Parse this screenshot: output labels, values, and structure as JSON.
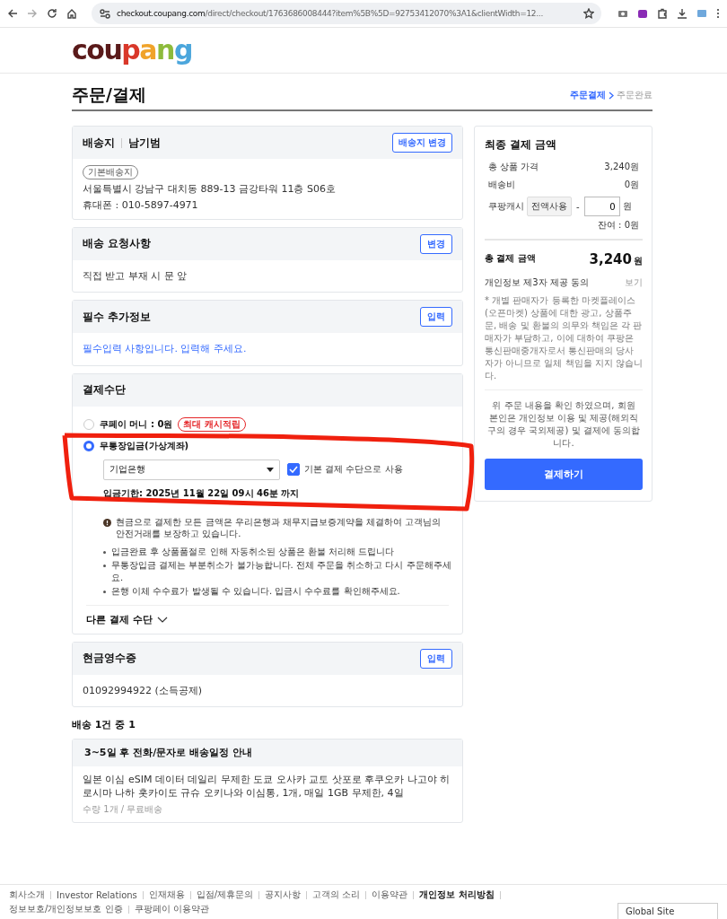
{
  "browser": {
    "url_host": "checkout.coupang.com",
    "url_path": "/direct/checkout/1763686008444?item%5B%5D=92753412070%3A1&clientWidth=12..."
  },
  "logo": "coupang",
  "page_title": "주문/결제",
  "steps": [
    {
      "label": "주문결제",
      "selected": true
    },
    {
      "label": "주문완료",
      "selected": false
    }
  ],
  "shipping_address": {
    "title": "배송지",
    "name": "남기범",
    "button": "배송지 변경",
    "badge": "기본배송지",
    "address": "서울특별시 강남구 대치동 889-13 금강타워 11층 S06호",
    "phone": "휴대폰 : 010-5897-4971"
  },
  "delivery_request": {
    "title": "배송 요청사항",
    "button": "변경",
    "text": "직접 받고 부재 시 문 앞"
  },
  "extra_info": {
    "title": "필수 추가정보",
    "button": "입력",
    "text": "필수입력 사항입니다. 입력해 주세요."
  },
  "payment": {
    "title": "결제수단",
    "methods": [
      {
        "label": "쿠페이 머니 : 0원",
        "badge": "최대 캐시적립",
        "selected": false
      },
      {
        "label": "무통장입금(가상계좌)",
        "selected": true
      }
    ],
    "bank_select": "기업은행",
    "default_checkbox": {
      "label": "기본 결제 수단으로 사용",
      "checked": true
    },
    "deadline": "입금기한:  2025년 11월 22일 09시 46분 까지",
    "notice": "현금으로 결제한 모든 금액은 우리은행과 채무지급보증계약을 체결하여 고객님의 안전거래를 보장하고 있습니다.",
    "bullets": [
      "입금완료 후 상품품절로 인해 자동취소된 상품은 환불 처리해 드립니다",
      "무통장입금 결제는 부분취소가 불가능합니다. 전체 주문을 취소하고 다시 주문해주세요.",
      "은행 이체 수수료가 발생될 수 있습니다. 입금시 수수료를 확인해주세요."
    ],
    "other_methods": "다른 결제 수단"
  },
  "cash_receipt": {
    "title": "현금영수증",
    "button": "입력",
    "text": "01092994922 (소득공제)"
  },
  "shipment": {
    "heading": "배송 1건 중 1",
    "title": "3~5일 후 전화/문자로 배송일정 안내",
    "product": "일본 이심 eSIM 데이터 데일리 무제한 도쿄 오사카 교토 삿포로 후쿠오카 나고야 히로시마 나하 홋카이도 규슈 오키나와 이심통, 1개, 매일 1GB 무제한, 4일",
    "meta": "수량 1개 / 무료배송"
  },
  "summary": {
    "title": "최종 결제 금액",
    "rows": [
      {
        "label": "총 상품 가격",
        "value": "3,240원"
      },
      {
        "label": "배송비",
        "value": "0원"
      }
    ],
    "cash": {
      "label": "쿠팡캐시",
      "button": "전액사용",
      "minus": "-",
      "value": "0",
      "unit": "원",
      "balance": "잔여 : 0원"
    },
    "total": {
      "label": "총 결제 금액",
      "amount": "3,240",
      "unit": "원"
    },
    "consent": {
      "label": "개인정보 제3자 제공 동의",
      "link": "보기"
    },
    "disclaimer": "* 개별 판매자가 등록한 마켓플레이스(오픈마켓) 상품에 대한 광고, 상품주문, 배송 및 환불의 의무와 책임은 각 판매자가 부담하고, 이에 대하여 쿠팡은 통신판매중개자로서 통신판매의 당사자가 아니므로 일체 책임을 지지 않습니다.",
    "agreement": "위 주문 내용을 확인 하였으며, 회원 본인은 개인정보 이용 및 제공(해외직구의 경우 국외제공) 및 결제에 동의합니다.",
    "pay_button": "결제하기"
  },
  "footer": {
    "links": [
      {
        "label": "회사소개",
        "bold": false
      },
      {
        "label": "Investor Relations",
        "bold": false
      },
      {
        "label": "인재채용",
        "bold": false
      },
      {
        "label": "입점/제휴문의",
        "bold": false
      },
      {
        "label": "공지사항",
        "bold": false
      },
      {
        "label": "고객의 소리",
        "bold": false
      },
      {
        "label": "이용약관",
        "bold": false
      },
      {
        "label": "개인정보 처리방침",
        "bold": true
      },
      {
        "label": "정보보호/개인정보보호 인증",
        "bold": false
      },
      {
        "label": "쿠팡페이 이용약관",
        "bold": false
      }
    ],
    "global_site": "Global Site"
  }
}
